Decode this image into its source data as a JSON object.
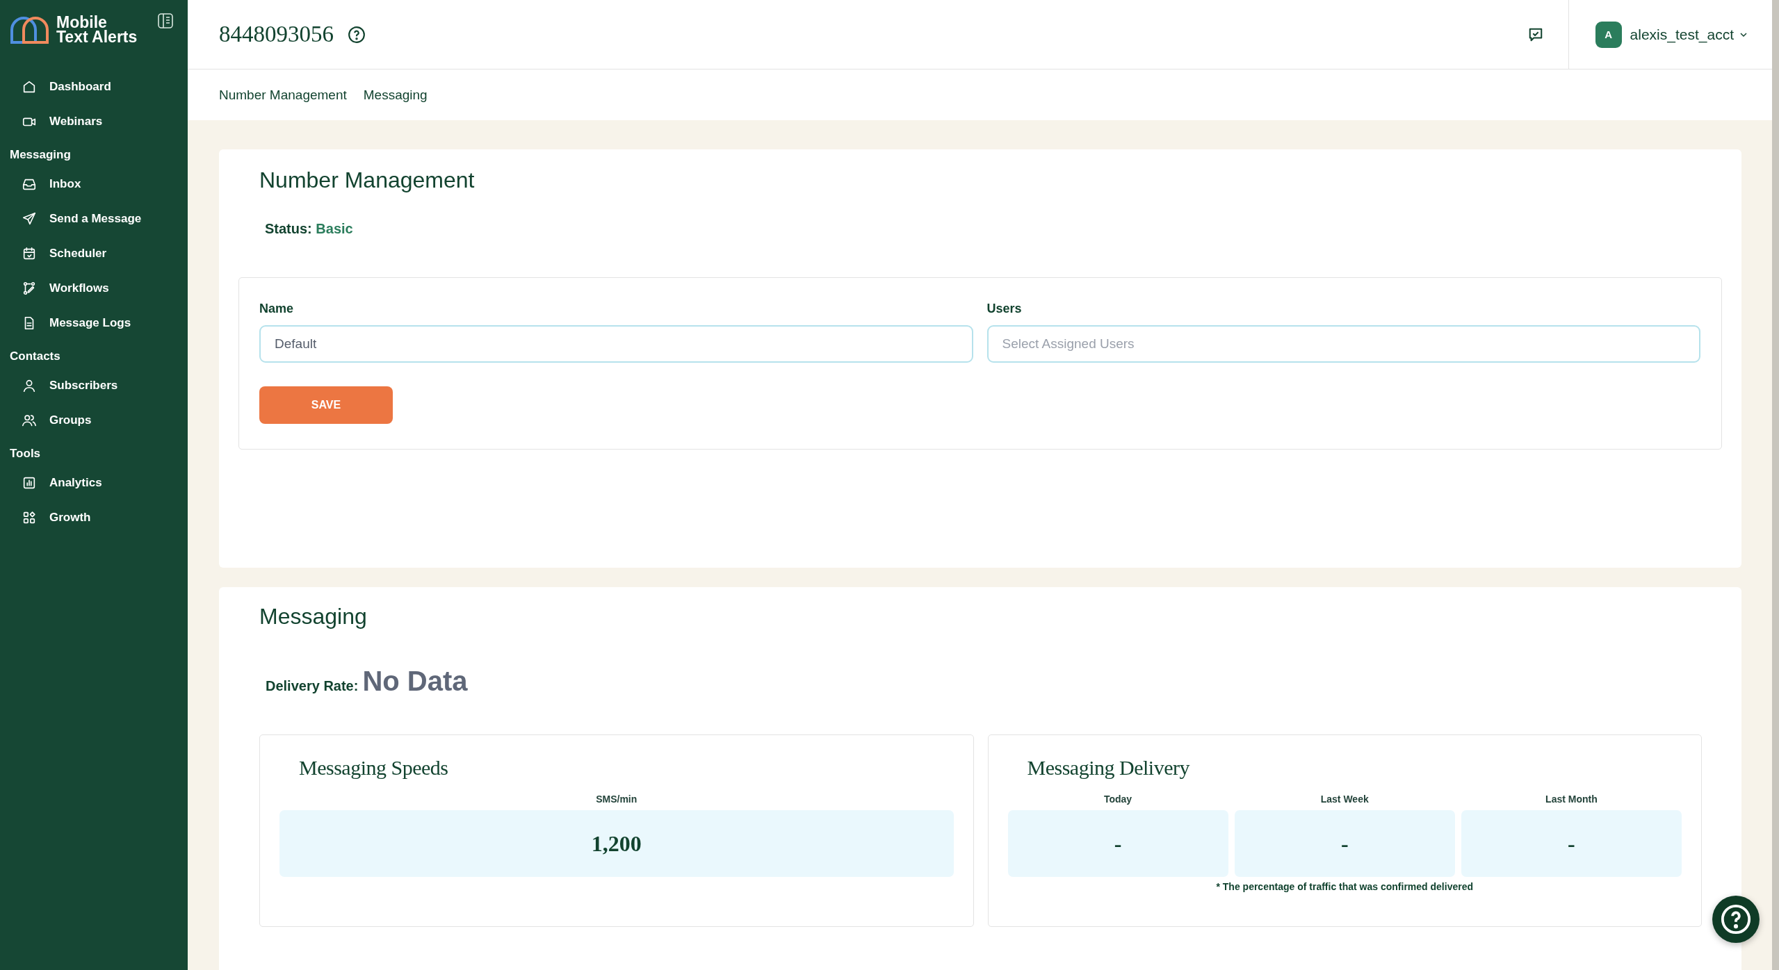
{
  "sidebar": {
    "logo_lines": [
      "Mobile",
      "Text Alerts"
    ],
    "sections": [
      {
        "items": [
          {
            "label": "Dashboard"
          },
          {
            "label": "Webinars"
          }
        ]
      },
      {
        "heading": "Messaging",
        "items": [
          {
            "label": "Inbox"
          },
          {
            "label": "Send a Message"
          },
          {
            "label": "Scheduler"
          },
          {
            "label": "Workflows"
          },
          {
            "label": "Message Logs"
          }
        ]
      },
      {
        "heading": "Contacts",
        "items": [
          {
            "label": "Subscribers"
          },
          {
            "label": "Groups"
          }
        ]
      },
      {
        "heading": "Tools",
        "items": [
          {
            "label": "Analytics"
          },
          {
            "label": "Growth"
          }
        ]
      }
    ]
  },
  "header": {
    "title": "8448093056",
    "user": {
      "initial": "A",
      "name": "alexis_test_acct"
    }
  },
  "tabs": [
    {
      "label": "Number Management"
    },
    {
      "label": "Messaging"
    }
  ],
  "number_management": {
    "title": "Number Management",
    "status_label": "Status:",
    "status_value": "Basic",
    "fields": [
      {
        "label": "Name",
        "value": "Default"
      },
      {
        "label": "Users",
        "placeholder": "Select Assigned Users"
      }
    ],
    "save_button": "SAVE"
  },
  "messaging": {
    "title": "Messaging",
    "delivery_label": "Delivery Rate:",
    "delivery_value": "No Data",
    "panels": [
      {
        "title": "Messaging Speeds",
        "stats": [
          {
            "label": "SMS/min",
            "value": "1,200"
          }
        ]
      },
      {
        "title": "Messaging Delivery",
        "stats": [
          {
            "label": "Today",
            "value": "-"
          },
          {
            "label": "Last Week",
            "value": "-"
          },
          {
            "label": "Last Month",
            "value": "-"
          }
        ],
        "footnote": "* The percentage of traffic that was confirmed delivered"
      }
    ]
  }
}
